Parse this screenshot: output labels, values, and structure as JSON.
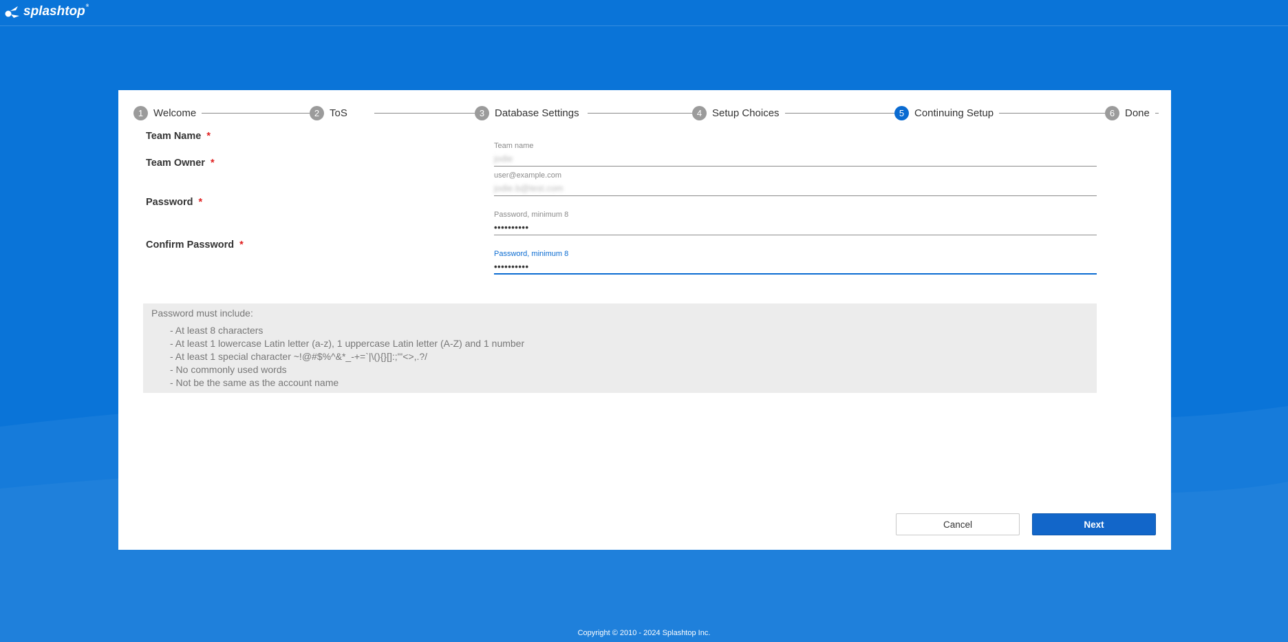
{
  "brand": {
    "name": "splashtop",
    "mark": "®"
  },
  "steps": [
    {
      "num": "1",
      "label": "Welcome",
      "state": "done"
    },
    {
      "num": "2",
      "label": "ToS",
      "state": "done"
    },
    {
      "num": "3",
      "label": "Database Settings",
      "state": "done"
    },
    {
      "num": "4",
      "label": "Setup Choices",
      "state": "done"
    },
    {
      "num": "5",
      "label": "Continuing Setup",
      "state": "active"
    },
    {
      "num": "6",
      "label": "Done",
      "state": "pending"
    }
  ],
  "form": {
    "team_name": {
      "label": "Team Name",
      "required": "*",
      "field_label": "Team name",
      "value": "jodie"
    },
    "team_owner": {
      "label": "Team Owner",
      "required": "*",
      "field_label": "user@example.com",
      "value": "jodie.b@test.com"
    },
    "password": {
      "label": "Password",
      "required": "*",
      "field_label": "Password, minimum 8",
      "value": "••••••••••"
    },
    "confirm_password": {
      "label": "Confirm Password",
      "required": "*",
      "field_label": "Password, minimum 8",
      "value": "••••••••••"
    }
  },
  "rules": {
    "title": "Password must include:",
    "items": [
      "- At least 8 characters",
      "- At least 1 lowercase Latin letter (a-z), 1 uppercase Latin letter (A-Z) and 1 number",
      "- At least 1 special character ~!@#$%^&*_-+=`|\\(){}[]:;\"'<>,.?/",
      "- No commonly used words",
      "- Not be the same as the account name"
    ]
  },
  "buttons": {
    "cancel": "Cancel",
    "next": "Next"
  },
  "footer": "Copyright © 2010 - 2024 Splashtop Inc.",
  "colors": {
    "background": "#0a74d8",
    "accent": "#0a6bd1",
    "next_button": "#1266c9",
    "required": "#e02020"
  }
}
